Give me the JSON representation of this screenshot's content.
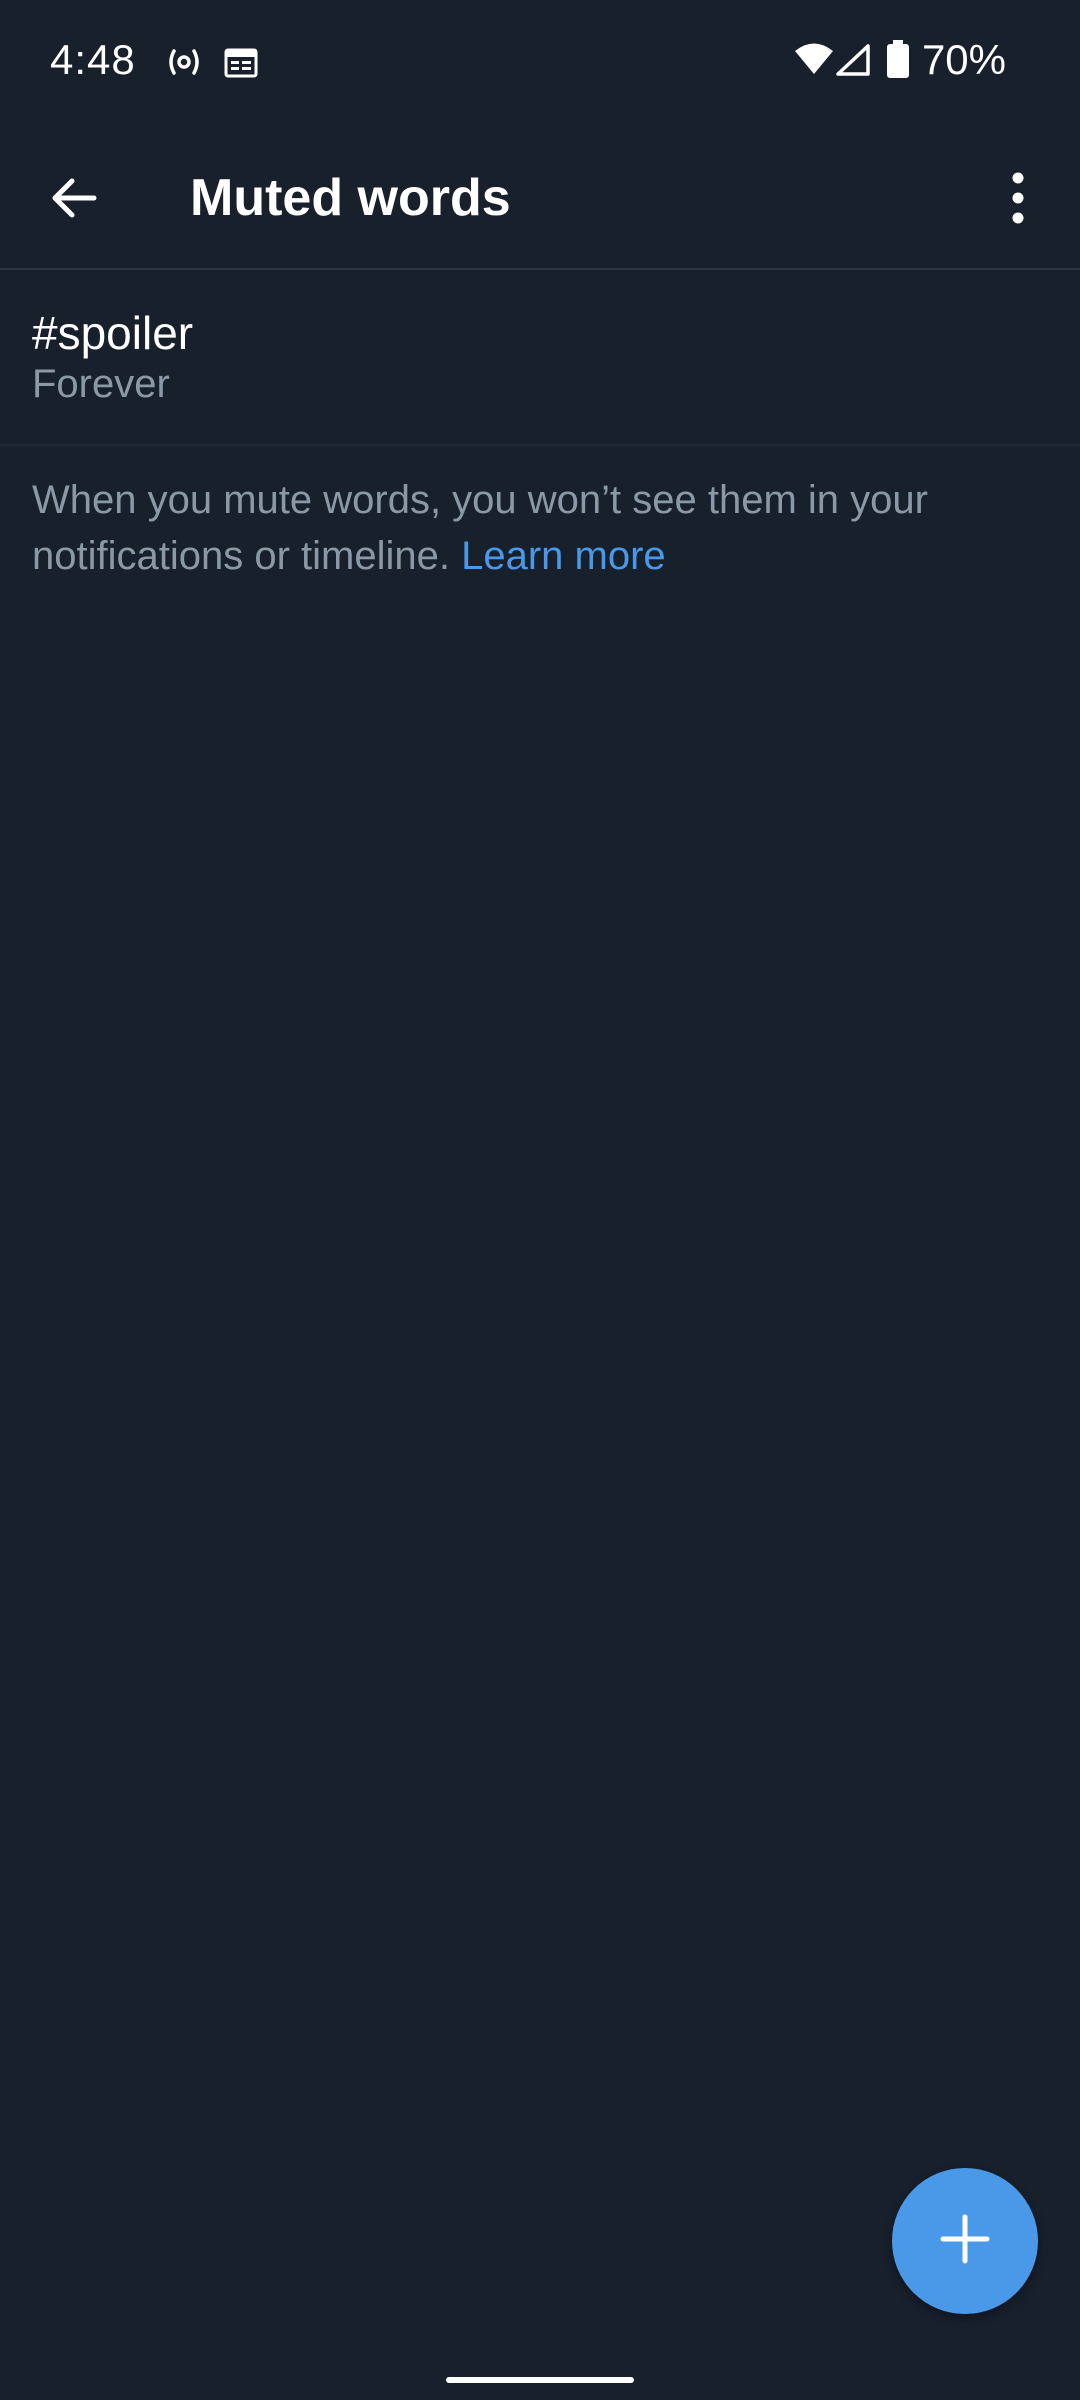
{
  "status_bar": {
    "time": "4:48",
    "battery_percent": "70%",
    "icons": [
      "hotspot-icon",
      "calendar-icon",
      "wifi-icon",
      "signal-icon",
      "battery-icon"
    ]
  },
  "app_bar": {
    "title": "Muted words",
    "back_icon": "arrow-left-icon",
    "overflow_icon": "more-vertical-icon"
  },
  "muted_words": [
    {
      "word": "#spoiler",
      "duration": "Forever"
    }
  ],
  "info": {
    "text": "When you mute words, you won’t see them in your notifications or timeline.",
    "link_label": "Learn more"
  },
  "fab": {
    "icon": "plus-icon"
  },
  "colors": {
    "background": "#18202c",
    "accent": "#4a99e9",
    "secondary_text": "#8b98a5",
    "primary_text": "#ffffff"
  }
}
